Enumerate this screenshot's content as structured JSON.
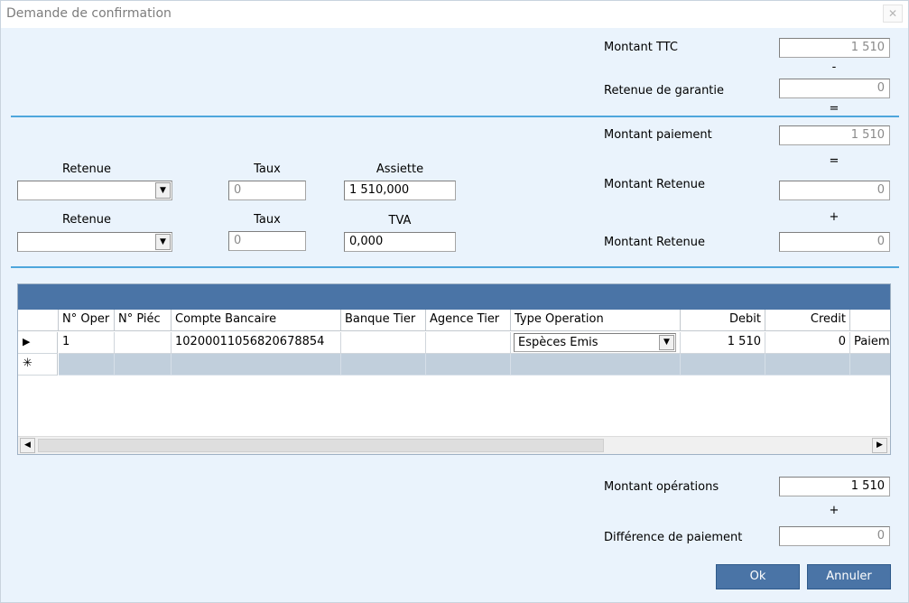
{
  "window": {
    "title": "Demande de confirmation",
    "close_glyph": "✕"
  },
  "summary": {
    "montant_ttc": {
      "label": "Montant TTC",
      "value": "1 510"
    },
    "op_minus": "-",
    "retenue_garantie": {
      "label": "Retenue de garantie",
      "value": "0"
    },
    "op_equals1": "=",
    "montant_paiement": {
      "label": "Montant paiement",
      "value": "1 510"
    },
    "op_equals2": "=",
    "montant_retenue_1": {
      "label": "Montant Retenue",
      "value": "0"
    },
    "op_plus": "+",
    "montant_retenue_2": {
      "label": "Montant Retenue",
      "value": "0"
    }
  },
  "retenue_rows": [
    {
      "retenue_label": "Retenue",
      "retenue_value": "",
      "taux_label": "Taux",
      "taux_value": "0",
      "third_label": "Assiette",
      "third_value": "1 510,000"
    },
    {
      "retenue_label": "Retenue",
      "retenue_value": "",
      "taux_label": "Taux",
      "taux_value": "0",
      "third_label": "TVA",
      "third_value": "0,000"
    }
  ],
  "grid": {
    "columns": [
      "N° Oper",
      "N° Piéc",
      "Compte Bancaire",
      "Banque Tier",
      "Agence Tier",
      "Type Operation",
      "Debit",
      "Credit"
    ],
    "rows": [
      {
        "num_oper": "1",
        "num_piece": "",
        "compte": "10200011056820678854",
        "banque": "",
        "agence": "",
        "type_operation": "Espèces Emis",
        "debit": "1 510",
        "credit": "0",
        "extra": "Paiem"
      }
    ],
    "new_row_marker": "✳",
    "current_row_marker": "▶"
  },
  "footer": {
    "montant_operations": {
      "label": "Montant opérations",
      "value": "1 510"
    },
    "op_plus": "+",
    "difference_paiement": {
      "label": "Différence de paiement",
      "value": "0"
    },
    "ok_label": "Ok",
    "annuler_label": "Annuler"
  },
  "colors": {
    "accent": "#4a74a6",
    "separator": "#4ea6dc",
    "background": "#eaf3fc"
  }
}
